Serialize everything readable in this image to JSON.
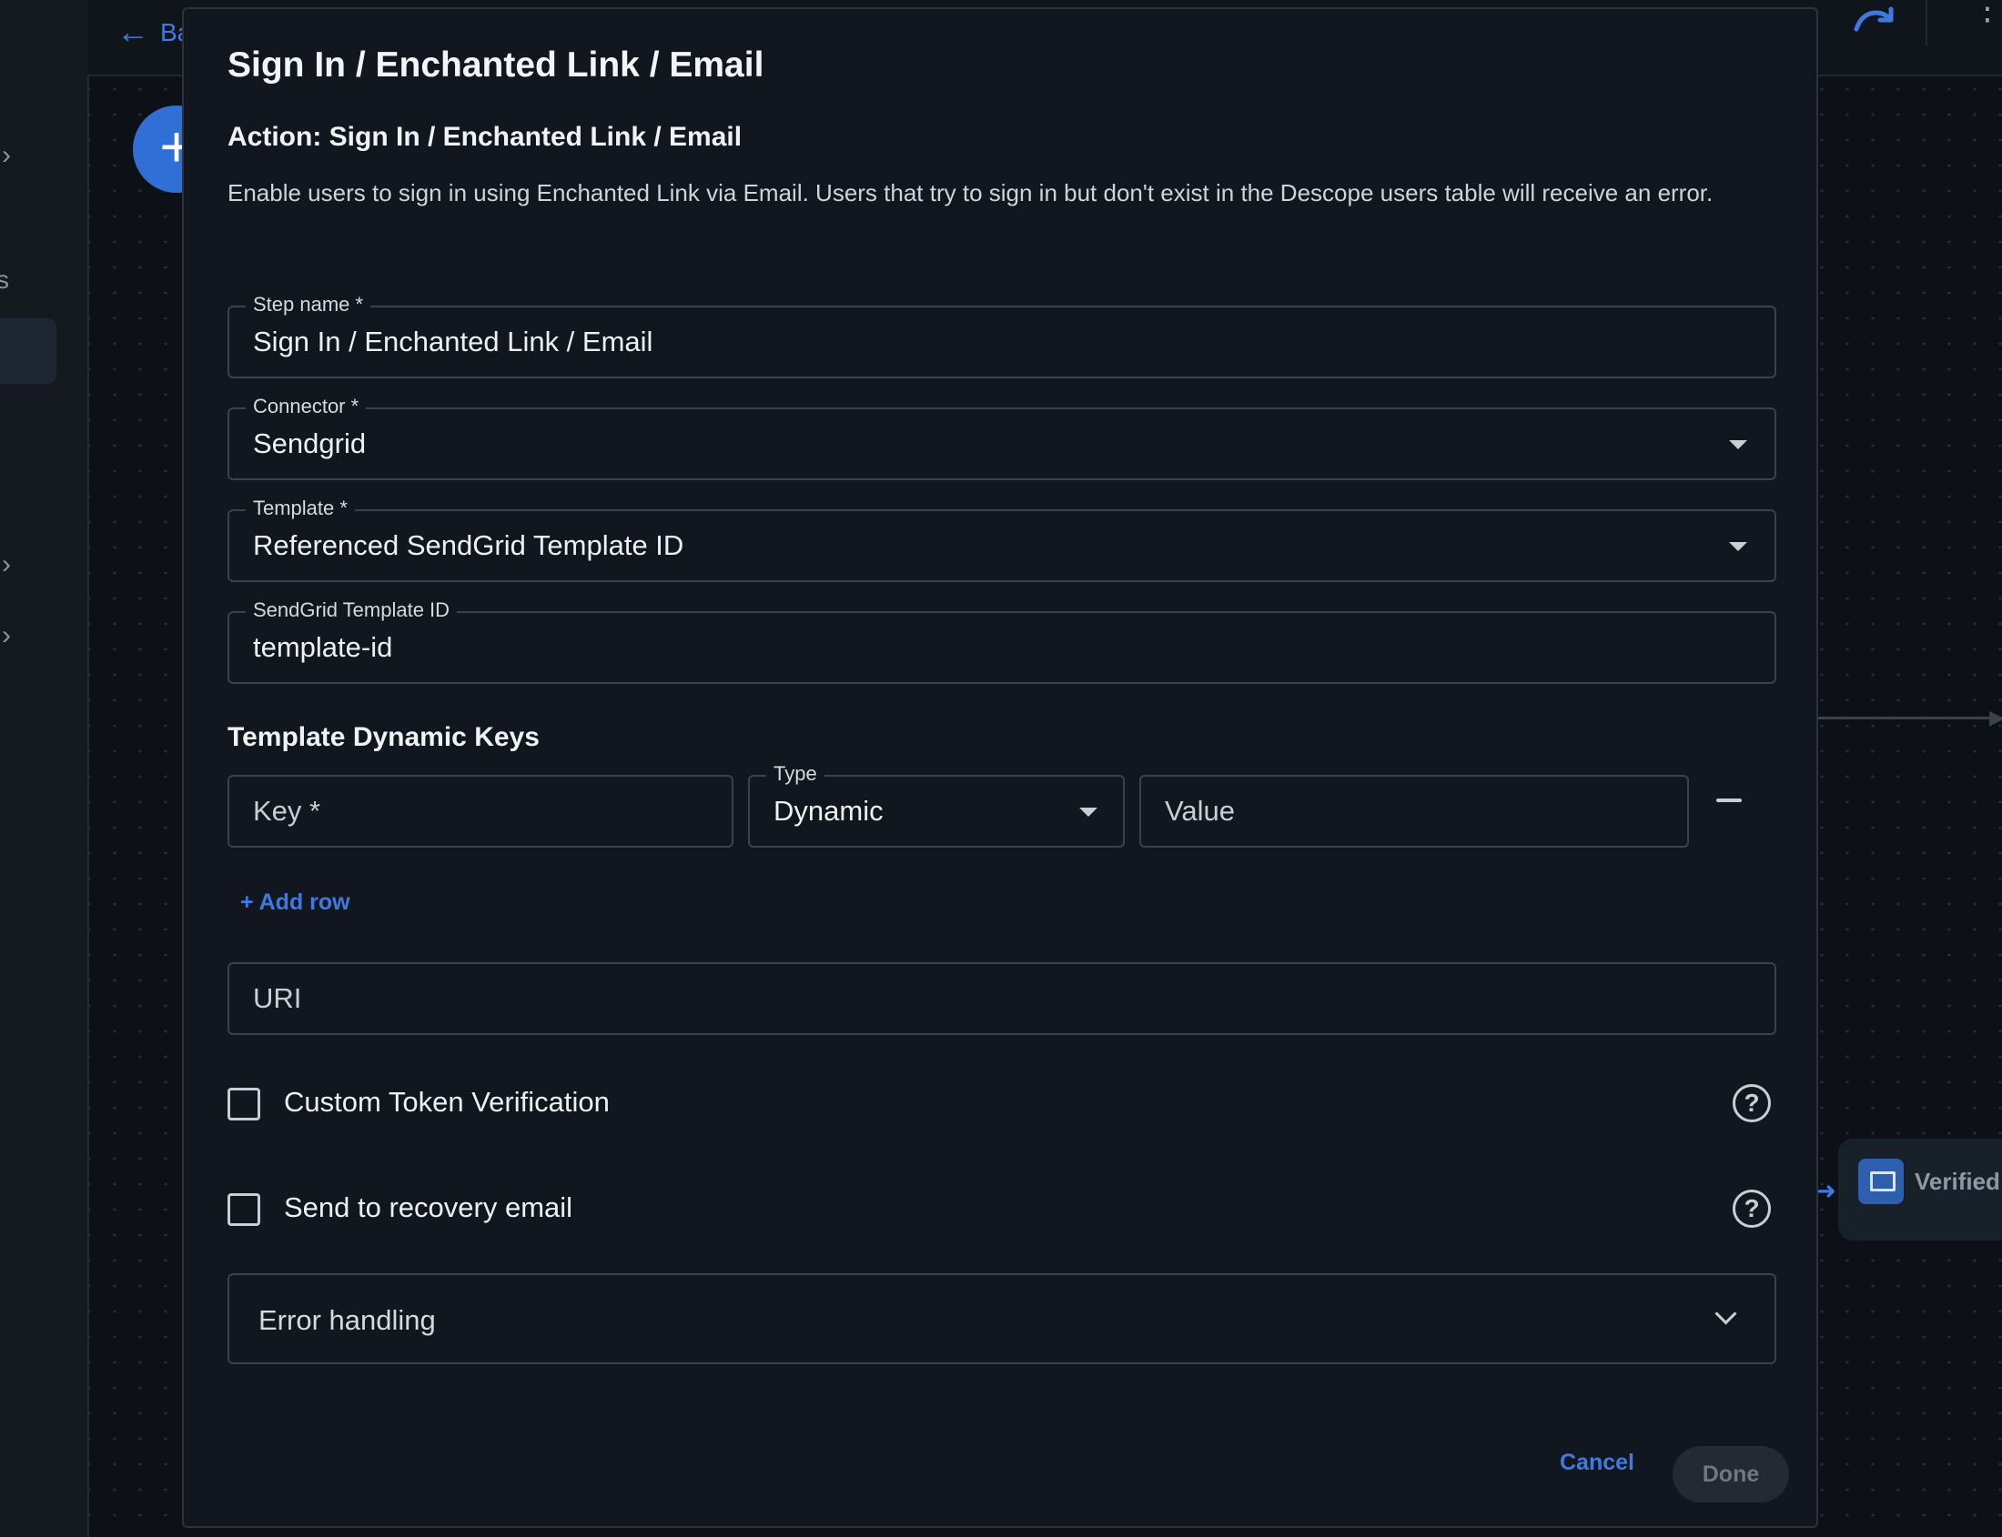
{
  "background": {
    "back_label": "Ba",
    "add_symbol": "+",
    "node_label": "Verified S",
    "rail_letter": "s"
  },
  "modal": {
    "title": "Sign In / Enchanted Link / Email",
    "action_title": "Action: Sign In / Enchanted Link / Email",
    "description": "Enable users to sign in using Enchanted Link via Email. Users that try to sign in but don't exist in the Descope users table will receive an error.",
    "fields": {
      "step_name": {
        "label": "Step name *",
        "value": "Sign In / Enchanted Link / Email"
      },
      "connector": {
        "label": "Connector *",
        "value": "Sendgrid"
      },
      "template": {
        "label": "Template *",
        "value": "Referenced SendGrid Template ID"
      },
      "sendgrid_template_id": {
        "label": "SendGrid Template ID",
        "value": "template-id"
      }
    },
    "dynamic_keys": {
      "title": "Template Dynamic Keys",
      "key_placeholder": "Key *",
      "type_label": "Type",
      "type_value": "Dynamic",
      "value_placeholder": "Value",
      "add_row": "+ Add row"
    },
    "uri_placeholder": "URI",
    "checkboxes": {
      "custom_token": {
        "label": "Custom Token Verification",
        "checked": false
      },
      "recovery_email": {
        "label": "Send to recovery email",
        "checked": false
      }
    },
    "help_glyph": "?",
    "error_handling": "Error handling",
    "buttons": {
      "cancel": "Cancel",
      "done": "Done"
    }
  },
  "colors": {
    "accent": "#3d7be3",
    "modal_bg": "#12171f",
    "page_bg": "#0d1117",
    "border": "#3a424d"
  }
}
